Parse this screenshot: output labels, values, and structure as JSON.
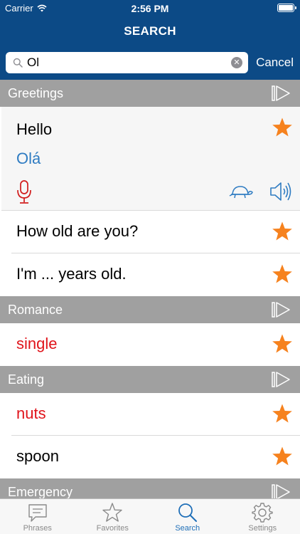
{
  "status_bar": {
    "carrier": "Carrier",
    "time": "2:56 PM"
  },
  "header": {
    "title": "SEARCH"
  },
  "search": {
    "value": "Ol",
    "cancel_label": "Cancel"
  },
  "sections": [
    {
      "title": "Greetings",
      "expanded_item": {
        "phrase": "Hello",
        "translation": "Olá",
        "favorite": true
      },
      "items": [
        {
          "text": "How old are you?",
          "favorite": true
        },
        {
          "text": "I'm ... years old.",
          "favorite": true
        }
      ]
    },
    {
      "title": "Romance",
      "items": [
        {
          "text": "single",
          "favorite": true
        }
      ]
    },
    {
      "title": "Eating",
      "items": [
        {
          "text": "nuts",
          "favorite": true
        },
        {
          "text": "spoon",
          "favorite": true
        }
      ]
    },
    {
      "title": "Emergency",
      "items": []
    }
  ],
  "tabs": [
    {
      "label": "Phrases",
      "icon": "speech-bubble-icon",
      "active": false
    },
    {
      "label": "Favorites",
      "icon": "star-outline-icon",
      "active": false
    },
    {
      "label": "Search",
      "icon": "magnifier-icon",
      "active": true
    },
    {
      "label": "Settings",
      "icon": "gear-icon",
      "active": false
    }
  ],
  "colors": {
    "header_bg": "#0c4a86",
    "section_bg": "#a0a0a0",
    "star": "#f6821e",
    "translation": "#2f7cc2",
    "match_highlight": "#e0141b",
    "mic": "#d11a1a",
    "tab_active": "#1f6fb8"
  }
}
